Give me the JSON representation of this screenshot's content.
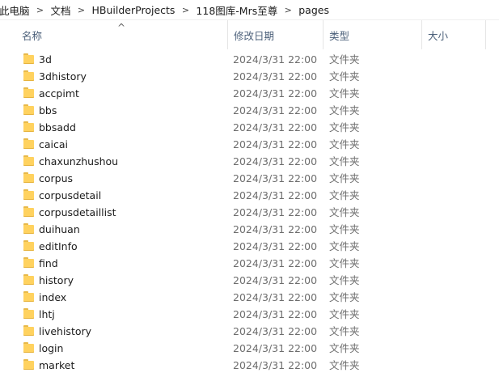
{
  "breadcrumb": [
    "此电脑",
    "文档",
    "HBuilderProjects",
    "118图库-Mrs至尊",
    "pages"
  ],
  "breadcrumb_separator": ">",
  "columns": {
    "name": "名称",
    "date": "修改日期",
    "type": "类型",
    "size": "大小"
  },
  "sort_indicator": "^",
  "rows": [
    {
      "name": "3d",
      "date": "2024/3/31 22:00",
      "type": "文件夹"
    },
    {
      "name": "3dhistory",
      "date": "2024/3/31 22:00",
      "type": "文件夹"
    },
    {
      "name": "accpimt",
      "date": "2024/3/31 22:00",
      "type": "文件夹"
    },
    {
      "name": "bbs",
      "date": "2024/3/31 22:00",
      "type": "文件夹"
    },
    {
      "name": "bbsadd",
      "date": "2024/3/31 22:00",
      "type": "文件夹"
    },
    {
      "name": "caicai",
      "date": "2024/3/31 22:00",
      "type": "文件夹"
    },
    {
      "name": "chaxunzhushou",
      "date": "2024/3/31 22:00",
      "type": "文件夹"
    },
    {
      "name": "corpus",
      "date": "2024/3/31 22:00",
      "type": "文件夹"
    },
    {
      "name": "corpusdetail",
      "date": "2024/3/31 22:00",
      "type": "文件夹"
    },
    {
      "name": "corpusdetaillist",
      "date": "2024/3/31 22:00",
      "type": "文件夹"
    },
    {
      "name": "duihuan",
      "date": "2024/3/31 22:00",
      "type": "文件夹"
    },
    {
      "name": "editInfo",
      "date": "2024/3/31 22:00",
      "type": "文件夹"
    },
    {
      "name": "find",
      "date": "2024/3/31 22:00",
      "type": "文件夹"
    },
    {
      "name": "history",
      "date": "2024/3/31 22:00",
      "type": "文件夹"
    },
    {
      "name": "index",
      "date": "2024/3/31 22:00",
      "type": "文件夹"
    },
    {
      "name": "lhtj",
      "date": "2024/3/31 22:00",
      "type": "文件夹"
    },
    {
      "name": "livehistory",
      "date": "2024/3/31 22:00",
      "type": "文件夹"
    },
    {
      "name": "login",
      "date": "2024/3/31 22:00",
      "type": "文件夹"
    },
    {
      "name": "market",
      "date": "2024/3/31 22:00",
      "type": "文件夹"
    }
  ],
  "row_icon": "folder-icon",
  "colors": {
    "header_text": "#4c607a",
    "secondary_text": "#6d6d6d",
    "folder": "#ffd25f"
  }
}
